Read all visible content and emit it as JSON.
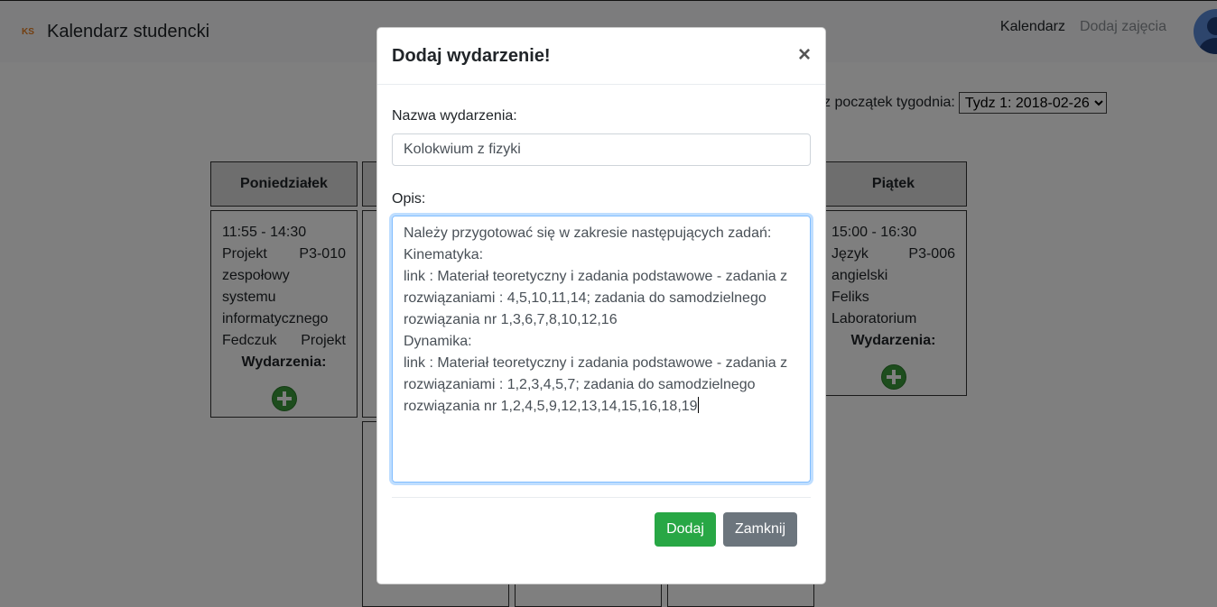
{
  "navbar": {
    "logo": "KS",
    "title": "Kalendarz studencki",
    "links": [
      "Kalendarz",
      "Dodaj zajęcia"
    ]
  },
  "week_selector": {
    "label": "z początek tygodnia:",
    "value": "Tydz 1: 2018-02-26"
  },
  "calendar": {
    "monday": {
      "header": "Poniedziałek",
      "time": "11:55 - 14:30",
      "course_type": "Projekt",
      "room": "P3-010",
      "course_line2": "zespołowy systemu",
      "course_line3": "informatycznego",
      "lecturer": "Fedczuk",
      "type": "Projekt",
      "events_label": "Wydarzenia:"
    },
    "friday": {
      "header": "Piątek",
      "time": "15:00 - 16:30",
      "course": "Język",
      "room": "P3-006",
      "course_line2": "angielski",
      "lecturer_type": "Feliks Laboratorium",
      "events_label": "Wydarzenia:"
    }
  },
  "modal": {
    "title": "Dodaj wydarzenie!",
    "close_symbol": "×",
    "name_label": "Nazwa wydarzenia:",
    "name_value": "Kolokwium z fizyki",
    "desc_label": "Opis:",
    "desc_value": "Należy przygotować się w zakresie następujących zadań:\nKinematyka:\nlink : Materiał teoretyczny i zadania podstawowe - zadania z rozwiązaniami : 4,5,10,11,14; zadania do samodzielnego rozwiązania nr 1,3,6,7,8,10,12,16\nDynamika:\nlink : Materiał teoretyczny i zadania podstawowe - zadania z rozwiązaniami : 1,2,3,4,5,7; zadania do samodzielnego rozwiązania nr 1,2,4,5,9,12,13,14,15,16,18,19",
    "add_button": "Dodaj",
    "close_button": "Zamknij"
  }
}
